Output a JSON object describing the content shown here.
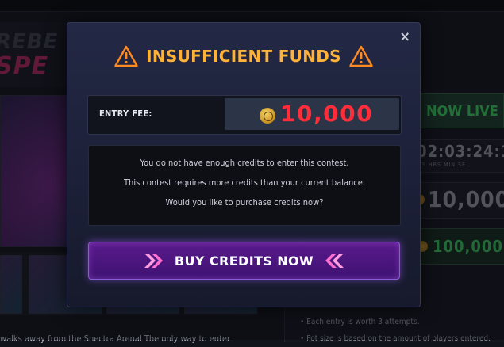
{
  "background": {
    "logo_text_top": "REBE",
    "logo_text_bottom": "SPE",
    "live_badge": "NOW LIVE",
    "countdown_values": "02:03:24:1",
    "countdown_units": "YS   HRS   MIN   SE",
    "prize_top": "10,000",
    "prize_second": "100,000",
    "caption": "walks away from the Snectra Arenal The only way to enter",
    "bullets": [
      "• Each entry is worth 3 attempts.",
      "• Pot size is based on the amount of players entered."
    ]
  },
  "modal": {
    "close_symbol": "×",
    "title": "INSUFFICIENT FUNDS",
    "entry_fee_label": "ENTRY FEE:",
    "entry_fee_value": "10,000",
    "messages": [
      "You do not have enough credits to enter this contest.",
      "This contest requires more credits than your current balance.",
      "Would you like to purchase credits now?"
    ],
    "buy_label": "BUY CREDITS NOW"
  },
  "colors": {
    "warning": "#ffb23a",
    "fee_red": "#ff2d3a",
    "button_purple": "#5a1a8c",
    "live_green": "#37c35b"
  },
  "icons": {
    "close": "close-icon",
    "warning": "warning-triangle-icon",
    "coin": "coin-icon",
    "chevrons": "double-chevron-icon"
  }
}
